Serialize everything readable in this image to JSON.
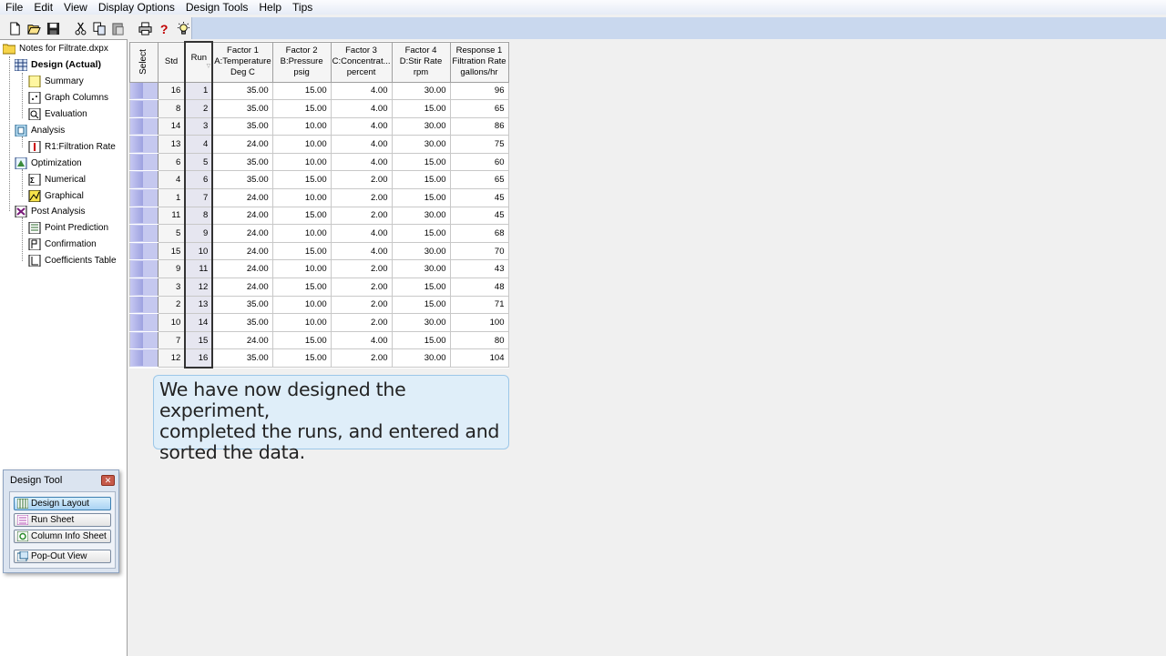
{
  "menu": [
    "File",
    "Edit",
    "View",
    "Display Options",
    "Design Tools",
    "Help",
    "Tips"
  ],
  "toolbar": {
    "icons": [
      "new-file-icon",
      "open-folder-icon",
      "save-icon",
      "cut-icon",
      "copy-icon",
      "paste-icon",
      "print-icon",
      "help-icon",
      "tip-lightbulb-icon"
    ]
  },
  "tree": {
    "root": "Notes for Filtrate.dxpx",
    "design": "Design (Actual)",
    "summary": "Summary",
    "graph_columns": "Graph Columns",
    "evaluation": "Evaluation",
    "analysis": "Analysis",
    "r1": "R1:Filtration Rate",
    "optimization": "Optimization",
    "numerical": "Numerical",
    "graphical": "Graphical",
    "post_analysis": "Post Analysis",
    "point_prediction": "Point Prediction",
    "confirmation": "Confirmation",
    "coefficients_table": "Coefficients Table"
  },
  "grid": {
    "headers": {
      "select": "Select",
      "std": "Std",
      "run": "Run",
      "f1": [
        "Factor 1",
        "A:Temperature",
        "Deg C"
      ],
      "f2": [
        "Factor 2",
        "B:Pressure",
        "psig"
      ],
      "f3": [
        "Factor 3",
        "C:Concentrat...",
        "percent"
      ],
      "f4": [
        "Factor 4",
        "D:Stir Rate",
        "rpm"
      ],
      "r1": [
        "Response 1",
        "Filtration Rate",
        "gallons/hr"
      ]
    },
    "rows": [
      [
        "16",
        "1",
        "35.00",
        "15.00",
        "4.00",
        "30.00",
        "96"
      ],
      [
        "8",
        "2",
        "35.00",
        "15.00",
        "4.00",
        "15.00",
        "65"
      ],
      [
        "14",
        "3",
        "35.00",
        "10.00",
        "4.00",
        "30.00",
        "86"
      ],
      [
        "13",
        "4",
        "24.00",
        "10.00",
        "4.00",
        "30.00",
        "75"
      ],
      [
        "6",
        "5",
        "35.00",
        "10.00",
        "4.00",
        "15.00",
        "60"
      ],
      [
        "4",
        "6",
        "35.00",
        "15.00",
        "2.00",
        "15.00",
        "65"
      ],
      [
        "1",
        "7",
        "24.00",
        "10.00",
        "2.00",
        "15.00",
        "45"
      ],
      [
        "11",
        "8",
        "24.00",
        "15.00",
        "2.00",
        "30.00",
        "45"
      ],
      [
        "5",
        "9",
        "24.00",
        "10.00",
        "4.00",
        "15.00",
        "68"
      ],
      [
        "15",
        "10",
        "24.00",
        "15.00",
        "4.00",
        "30.00",
        "70"
      ],
      [
        "9",
        "11",
        "24.00",
        "10.00",
        "2.00",
        "30.00",
        "43"
      ],
      [
        "3",
        "12",
        "24.00",
        "15.00",
        "2.00",
        "15.00",
        "48"
      ],
      [
        "2",
        "13",
        "35.00",
        "10.00",
        "2.00",
        "15.00",
        "71"
      ],
      [
        "10",
        "14",
        "35.00",
        "10.00",
        "2.00",
        "30.00",
        "100"
      ],
      [
        "7",
        "15",
        "24.00",
        "15.00",
        "4.00",
        "15.00",
        "80"
      ],
      [
        "12",
        "16",
        "35.00",
        "15.00",
        "2.00",
        "30.00",
        "104"
      ]
    ]
  },
  "callout": {
    "line1": "We have now designed the experiment,",
    "line2": "completed the runs, and entered and",
    "line3": "sorted the data."
  },
  "design_tool": {
    "title": "Design Tool",
    "buttons": [
      "Design Layout",
      "Run Sheet",
      "Column Info Sheet",
      "Pop-Out View"
    ]
  }
}
